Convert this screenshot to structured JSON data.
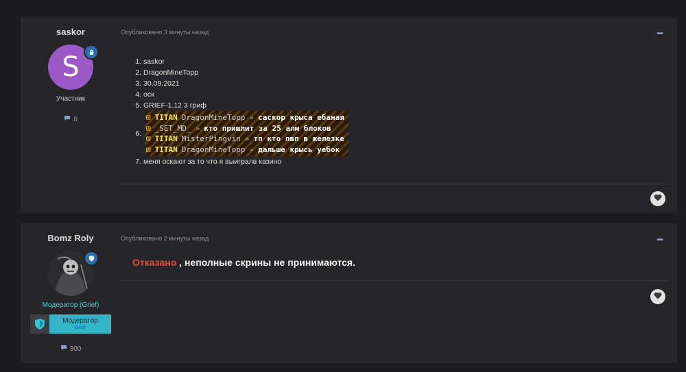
{
  "posts": [
    {
      "author": "saskor",
      "avatar_letter": "S",
      "role": "Участник",
      "post_count": "6",
      "published": "Опубликовано 3 минуты назад",
      "answers": [
        {
          "num": "1.",
          "text": "saskor"
        },
        {
          "num": "2.",
          "text": "DragonMineTopp"
        },
        {
          "num": "3.",
          "text": "30.09.2021"
        },
        {
          "num": "4.",
          "text": "оск"
        },
        {
          "num": "5.",
          "text": "GRIEF-1.12 3 гриф"
        },
        {
          "num": "6.",
          "text": ""
        },
        {
          "num": "7.",
          "text": "меня оскают за то что я выигралв казино"
        }
      ],
      "chat_lines": [
        {
          "mark": "⊡",
          "rank": "TITAN",
          "nick": "DragonMineTopp",
          "arrow": "»",
          "msg": "саскор крыса ебаная"
        },
        {
          "mark": "⊡",
          "rank": "",
          "nick": "_SET_MD_",
          "arrow": "»",
          "msg": "кто пришлит за 25 алм блоков"
        },
        {
          "mark": "⊡",
          "rank": "TITAN",
          "nick": "MisterPingvin",
          "arrow": "»",
          "msg": "тп кто пвп в железке"
        },
        {
          "mark": "⊡",
          "rank": "TITAN",
          "nick": "DragonMineTopp",
          "arrow": "»",
          "msg": "дальше крысь уебок"
        }
      ]
    },
    {
      "author": "Bomz Roly",
      "role": "Модератор (Grief)",
      "staff_badge": {
        "title": "Модератор",
        "subtitle": "Grief"
      },
      "post_count": "300",
      "published": "Опубликовано 2 минуты назад",
      "reply_highlight": "Отказано",
      "reply_rest": ", неполные скрины не принимаются."
    }
  ],
  "icons": {
    "more": "ellipsis-icon",
    "comment": "comment-icon",
    "like": "heart-icon",
    "role": "shield-icon"
  },
  "colors": {
    "page_bg": "#1c1c1e",
    "post_bg": "#262629",
    "avatar_purple": "#9b59c7",
    "moderator_badge": "#33b5c8",
    "refused_red": "#e04b3a"
  }
}
